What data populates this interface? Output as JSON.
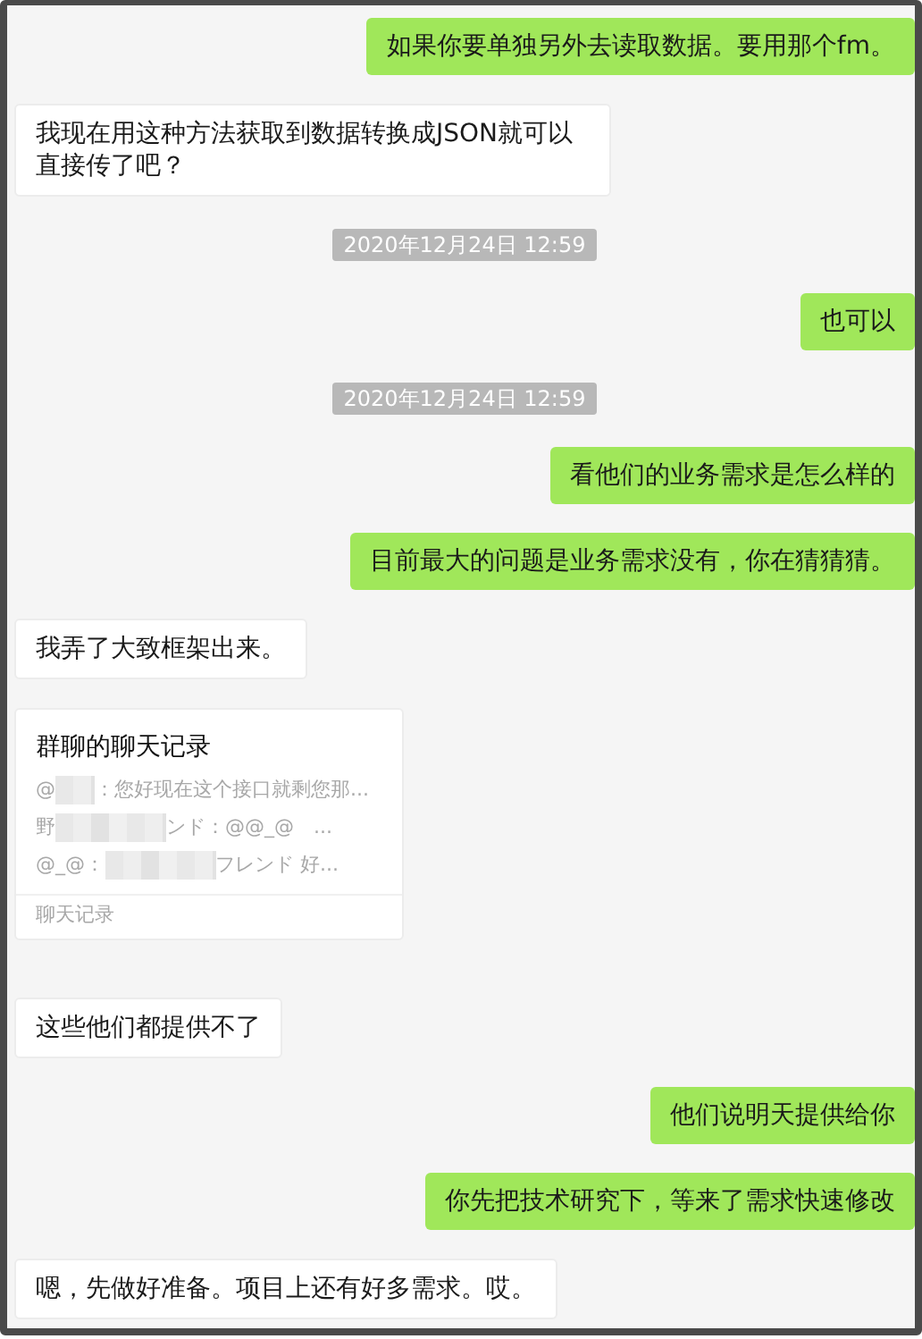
{
  "messages": [
    {
      "kind": "text",
      "mine": true,
      "text": "如果你要单独另外去读取数据。要用那个fm。"
    },
    {
      "kind": "text",
      "mine": false,
      "text": "我现在用这种方法获取到数据转换成JSON就可以直接传了吧？"
    },
    {
      "kind": "time",
      "text": "2020年12月24日 12:59"
    },
    {
      "kind": "text",
      "mine": true,
      "text": "也可以"
    },
    {
      "kind": "time",
      "text": "2020年12月24日 12:59"
    },
    {
      "kind": "text",
      "mine": true,
      "text": "看他们的业务需求是怎么样的"
    },
    {
      "kind": "text",
      "mine": true,
      "text": "目前最大的问题是业务需求没有，你在猜猜猜。"
    },
    {
      "kind": "text",
      "mine": false,
      "text": "我弄了大致框架出来。"
    },
    {
      "kind": "card",
      "title": "群聊的聊天记录",
      "lines": [
        [
          "@",
          "：您好现在这个接口就剩您那..."
        ],
        [
          "野",
          "ンド：@@_@　..."
        ],
        [
          "@_@：",
          "フレンド 好..."
        ]
      ],
      "footer": "聊天记录"
    },
    {
      "kind": "text",
      "mine": false,
      "text": "这些他们都提供不了"
    },
    {
      "kind": "text",
      "mine": true,
      "text": "他们说明天提供给你"
    },
    {
      "kind": "text",
      "mine": true,
      "text": "你先把技术研究下，等来了需求快速修改"
    },
    {
      "kind": "text",
      "mine": false,
      "text": "嗯，先做好准备。项目上还有好多需求。哎。"
    }
  ]
}
